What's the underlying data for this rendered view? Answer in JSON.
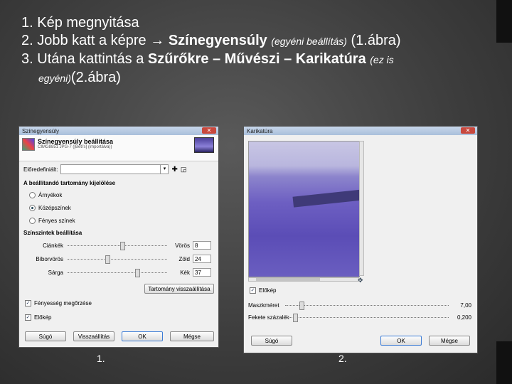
{
  "slide": {
    "lines": [
      {
        "num": "1.",
        "text": "Kép megnyitása"
      },
      {
        "num": "2.",
        "text": "Jobb katt a képre",
        "arrow": "→",
        "bold": "Színegyensúly",
        "small": "(egyéni beállítás)",
        "tail": "(1.ábra)"
      },
      {
        "num": "3.",
        "text": "Utána kattintás a",
        "bold": "Szűrőkre – Művészi – Karikatúra",
        "small": "(ez is",
        "small2": "egyéni)",
        "tail": "(2.ábra)"
      }
    ],
    "caption1": "1.",
    "caption2": "2."
  },
  "dialog1": {
    "title": "Színegyensúly",
    "header_title": "Színegyensúly beállítása",
    "header_sub": "CIMG8851 JPG-7 ([Beti's] (importálva))",
    "presets_label": "Előredefiniált:",
    "range_section": "A beállítandó tartomány kijelölése",
    "ranges": [
      {
        "label": "Árnyékok",
        "checked": false
      },
      {
        "label": "Középszínek",
        "checked": true
      },
      {
        "label": "Fényes színek",
        "checked": false
      }
    ],
    "adjust_section": "Színszintek beállítása",
    "sliders": [
      {
        "left": "Ciánkék",
        "right": "Vörös",
        "value": "8",
        "pos": 0.55
      },
      {
        "left": "Bíborvörös",
        "right": "Zöld",
        "value": "24",
        "pos": 0.4
      },
      {
        "left": "Sárga",
        "right": "Kék",
        "value": "37",
        "pos": 0.7
      }
    ],
    "reset_range_label": "Tartomány visszaállítása",
    "checks": [
      {
        "label": "Fényesség megőrzése",
        "checked": true
      },
      {
        "label": "Előkép",
        "checked": true
      }
    ],
    "buttons": {
      "help": "Súgó",
      "reset": "Visszaállítás",
      "ok": "OK",
      "cancel": "Mégse"
    }
  },
  "dialog2": {
    "title": "Karikatúra",
    "preview_check": "Előkép",
    "sliders": [
      {
        "label": "Maszkméret",
        "value": "7,00",
        "pos": 0.1
      },
      {
        "label": "Fekete százalék",
        "value": "0,200",
        "pos": 0.06
      }
    ],
    "buttons": {
      "help": "Súgó",
      "ok": "OK",
      "cancel": "Mégse"
    }
  }
}
